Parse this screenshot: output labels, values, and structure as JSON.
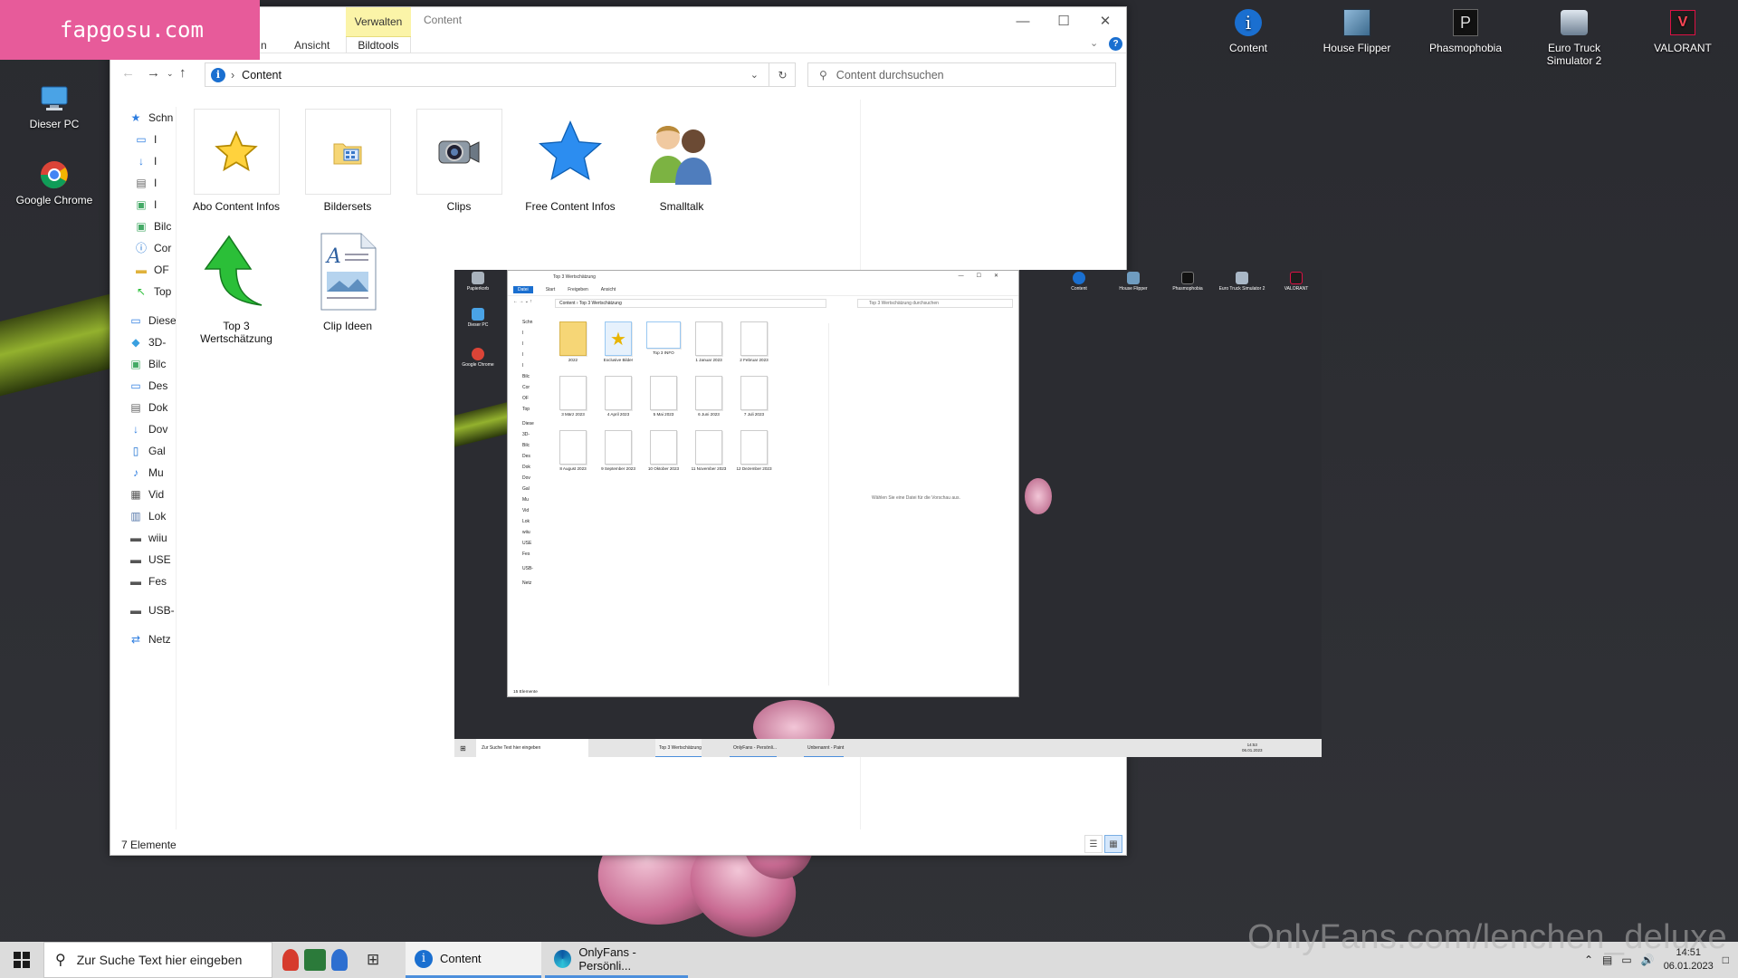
{
  "brand": {
    "text": "fapgosu.com"
  },
  "watermark": {
    "text": "OnlyFans.com/lenchen_deluxe"
  },
  "desktop_icons_left": [
    {
      "name": "dieser-pc",
      "label": "Dieser PC"
    },
    {
      "name": "google-chrome",
      "label": "Google Chrome"
    }
  ],
  "desktop_icons_top": [
    {
      "name": "content",
      "label": "Content"
    },
    {
      "name": "house-flipper",
      "label": "House Flipper"
    },
    {
      "name": "phasmophobia",
      "label": "Phasmophobia"
    },
    {
      "name": "euro-truck-simulator-2",
      "label": "Euro Truck Simulator 2"
    },
    {
      "name": "valorant",
      "label": "VALORANT"
    }
  ],
  "explorer": {
    "title": "Content",
    "ribbon": {
      "tab_partial": "n",
      "tab_ansicht": "Ansicht",
      "verwalten": "Verwalten",
      "bildtools": "Bildtools"
    },
    "address": "Content",
    "search_placeholder": "Content durchsuchen",
    "nav_items": [
      {
        "icon": "star",
        "label": "Schn"
      },
      {
        "icon": "desktop",
        "label": "I"
      },
      {
        "icon": "download",
        "label": "I"
      },
      {
        "icon": "document",
        "label": "I"
      },
      {
        "icon": "picture",
        "label": "I"
      },
      {
        "icon": "picture",
        "label": "Bilc"
      },
      {
        "icon": "info",
        "label": "Cor"
      },
      {
        "icon": "folder",
        "label": "OF"
      },
      {
        "icon": "arrow",
        "label": "Top"
      },
      {
        "icon": "spacer",
        "label": ""
      },
      {
        "icon": "pc",
        "label": "Diese"
      },
      {
        "icon": "cube",
        "label": "3D-"
      },
      {
        "icon": "picture",
        "label": "Bilc"
      },
      {
        "icon": "desktop",
        "label": "Des"
      },
      {
        "icon": "document",
        "label": "Dok"
      },
      {
        "icon": "download",
        "label": "Dov"
      },
      {
        "icon": "phone",
        "label": "Gal"
      },
      {
        "icon": "music",
        "label": "Mu"
      },
      {
        "icon": "video",
        "label": "Vid"
      },
      {
        "icon": "disk",
        "label": "Lok"
      },
      {
        "icon": "drive",
        "label": "wiiu"
      },
      {
        "icon": "drive",
        "label": "USE"
      },
      {
        "icon": "drive",
        "label": "Fes"
      },
      {
        "icon": "spacer",
        "label": ""
      },
      {
        "icon": "drive",
        "label": "USB-"
      },
      {
        "icon": "spacer",
        "label": ""
      },
      {
        "icon": "network",
        "label": "Netz"
      }
    ],
    "files": [
      {
        "name": "abo-content-infos",
        "label": "Abo Content Infos"
      },
      {
        "name": "bildersets",
        "label": "Bildersets"
      },
      {
        "name": "clips",
        "label": "Clips"
      },
      {
        "name": "free-content-infos",
        "label": "Free Content Infos"
      },
      {
        "name": "smalltalk",
        "label": "Smalltalk"
      },
      {
        "name": "top-3-wertschaetzung",
        "label": "Top 3 Wertschätzung"
      },
      {
        "name": "clip-ideen",
        "label": "Clip Ideen"
      }
    ],
    "status": "7 Elemente"
  },
  "mini": {
    "desktop_left": [
      "Papierkorb",
      "Dieser PC",
      "Google Chrome"
    ],
    "desktop_top": [
      "Content",
      "House Flipper",
      "Phasmophobia",
      "Euro Truck Simulator 2",
      "VALORANT"
    ],
    "title": "Top 3 Wertschätzung",
    "ribbon": [
      "Datei",
      "Start",
      "Freigeben",
      "Ansicht"
    ],
    "address": "Content  ›  Top 3 Wertschätzung",
    "search": "Top 3 Wertschätzung durchsuchen",
    "nav": [
      "Schn",
      "I",
      "I",
      "I",
      "I",
      "Bilc",
      "Cor",
      "OF",
      "Top",
      "",
      "Diese",
      "3D-",
      "Bilc",
      "Des",
      "Dok",
      "Dov",
      "Gal",
      "Mu",
      "Vid",
      "Lok",
      "wiiu",
      "USE",
      "Fes",
      "",
      "USB-",
      "",
      "Netz"
    ],
    "files": [
      "2022",
      "Exclusive Bilder",
      "Top 3 INFO",
      "1 Januar 2023",
      "2 Februar 2023",
      "3 März 2023",
      "4 April 2023",
      "5 Mai 2023",
      "6 Juni 2023",
      "7 Juli 2023",
      "8 August 2023",
      "9 September 2023",
      "10 Oktober 2023",
      "11 November 2023",
      "12 Dezember 2023"
    ],
    "preview_hint": "Wählen Sie eine Datei für die Vorschau aus.",
    "status": "15 Elemente",
    "taskbar": {
      "search": "Zur Suche Text hier eingeben",
      "apps": [
        "Top 3 Wertschätzung",
        "OnlyFans - Persönli...",
        "Unbenannt - Paint"
      ],
      "time": "14:53",
      "date": "06.01.2023"
    }
  },
  "taskbar": {
    "search_placeholder": "Zur Suche Text hier eingeben",
    "apps": [
      {
        "label": "Content"
      },
      {
        "label": "OnlyFans - Persönli..."
      }
    ],
    "time": "14:51",
    "date": "06.01.2023"
  }
}
